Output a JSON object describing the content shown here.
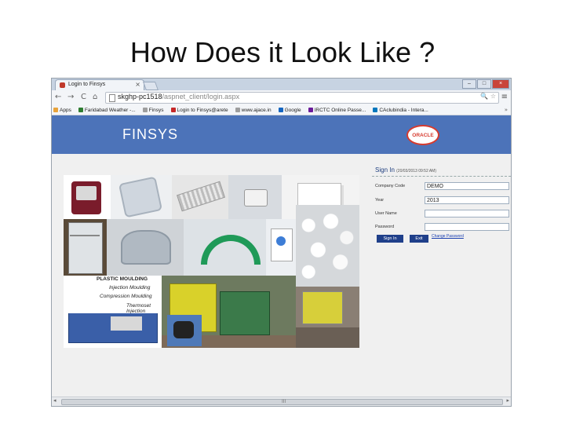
{
  "slide": {
    "title": "How Does it Look Like ?"
  },
  "browser": {
    "tab_title": "Login to Finsys",
    "tab_close": "×",
    "window_buttons": [
      "–",
      "□",
      "×"
    ],
    "nav": {
      "back": "←",
      "forward": "→",
      "reload": "C",
      "home": "⌂"
    },
    "url_host": "skghp-pc1518",
    "url_path": "/aspnet_client/login.aspx",
    "omnibox_icons": "🔍 ☆",
    "menu": "≡",
    "bookmarks": [
      {
        "label": "Apps",
        "color": "#e8a33c"
      },
      {
        "label": "Faridabad Weather -...",
        "color": "#2e7d32"
      },
      {
        "label": "Finsys",
        "color": "#9e9e9e"
      },
      {
        "label": "Login to Finsys@arete",
        "color": "#c62828"
      },
      {
        "label": "www.ajace.in",
        "color": "#9e9e9e"
      },
      {
        "label": "Google",
        "color": "#1565c0"
      },
      {
        "label": "IRCTC Online Passe...",
        "color": "#6a1b9a"
      },
      {
        "label": "CAclubindia - Intera...",
        "color": "#0277bd"
      }
    ],
    "bookmarks_more": "»"
  },
  "page": {
    "brand": "FINSYS",
    "oracle_logo": "ORACLE",
    "collage": {
      "heading": "PLASTIC MOULDING",
      "items": [
        "Injection Moulding",
        "Compression Moulding",
        "Thermoset Injection"
      ]
    },
    "signin": {
      "title": "Sign In",
      "timestamp": "(20/03/2013 09:52 AM)",
      "fields": [
        {
          "label": "Company Code",
          "value": "DEMO"
        },
        {
          "label": "Year",
          "value": "2013"
        },
        {
          "label": "User Name",
          "value": ""
        },
        {
          "label": "Password",
          "value": ""
        }
      ],
      "sign_in_button": "Sign In",
      "exit_button": "Exit",
      "change_password": "Change Password"
    },
    "scrollbar": {
      "left": "◂",
      "right": "▸",
      "grip": "III"
    }
  }
}
